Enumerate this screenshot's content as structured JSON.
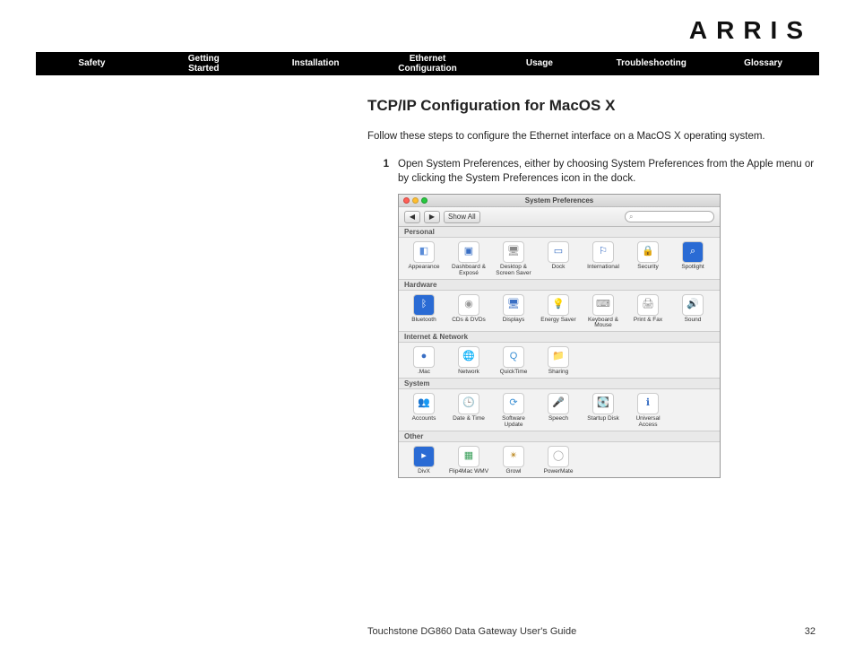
{
  "brand": "ARRIS",
  "nav": [
    "Safety",
    "Getting\nStarted",
    "Installation",
    "Ethernet\nConfiguration",
    "Usage",
    "Troubleshooting",
    "Glossary"
  ],
  "title": "TCP/IP Configuration for MacOS X",
  "intro": "Follow these steps to configure the Ethernet interface on a MacOS X operating system.",
  "step": {
    "num": "1",
    "text": "Open System Preferences, either by choosing System Preferences from the Apple menu or by clicking the System Preferences icon in the dock."
  },
  "sysprefs": {
    "windowTitle": "System Preferences",
    "showAll": "Show All",
    "searchGlyph": "⌕",
    "sections": [
      {
        "label": "Personal",
        "items": [
          {
            "name": "Appearance",
            "bg": "#fff",
            "glyph": "◧",
            "gc": "#5a8cd8"
          },
          {
            "name": "Dashboard & Exposé",
            "bg": "#fff",
            "glyph": "▣",
            "gc": "#3a6fc4"
          },
          {
            "name": "Desktop & Screen Saver",
            "bg": "#fff",
            "glyph": "🖥",
            "gc": "#888"
          },
          {
            "name": "Dock",
            "bg": "#fff",
            "glyph": "▭",
            "gc": "#3a6fc4"
          },
          {
            "name": "International",
            "bg": "#fff",
            "glyph": "⚐",
            "gc": "#2a62c0"
          },
          {
            "name": "Security",
            "bg": "#fff",
            "glyph": "🔒",
            "gc": "#777"
          },
          {
            "name": "Spotlight",
            "bg": "#2a6bd4",
            "glyph": "⌕",
            "gc": "#fff"
          }
        ]
      },
      {
        "label": "Hardware",
        "items": [
          {
            "name": "Bluetooth",
            "bg": "#2a6bd4",
            "glyph": "ᛒ",
            "gc": "#fff"
          },
          {
            "name": "CDs & DVDs",
            "bg": "#fff",
            "glyph": "◉",
            "gc": "#999"
          },
          {
            "name": "Displays",
            "bg": "#fff",
            "glyph": "🖥",
            "gc": "#3a6fc4"
          },
          {
            "name": "Energy Saver",
            "bg": "#fff",
            "glyph": "💡",
            "gc": "#e0c040"
          },
          {
            "name": "Keyboard & Mouse",
            "bg": "#fff",
            "glyph": "⌨",
            "gc": "#888"
          },
          {
            "name": "Print & Fax",
            "bg": "#fff",
            "glyph": "🖨",
            "gc": "#888"
          },
          {
            "name": "Sound",
            "bg": "#fff",
            "glyph": "🔊",
            "gc": "#b79a5a"
          }
        ]
      },
      {
        "label": "Internet & Network",
        "items": [
          {
            "name": ".Mac",
            "bg": "#fff",
            "glyph": "●",
            "gc": "#3a6fc4"
          },
          {
            "name": "Network",
            "bg": "#fff",
            "glyph": "🌐",
            "gc": "#3a6fc4"
          },
          {
            "name": "QuickTime",
            "bg": "#fff",
            "glyph": "Q",
            "gc": "#3a8fd4"
          },
          {
            "name": "Sharing",
            "bg": "#fff",
            "glyph": "📁",
            "gc": "#d4a03a"
          }
        ]
      },
      {
        "label": "System",
        "items": [
          {
            "name": "Accounts",
            "bg": "#fff",
            "glyph": "👥",
            "gc": "#333"
          },
          {
            "name": "Date & Time",
            "bg": "#fff",
            "glyph": "🕒",
            "gc": "#888"
          },
          {
            "name": "Software Update",
            "bg": "#fff",
            "glyph": "⟳",
            "gc": "#3a8fd4"
          },
          {
            "name": "Speech",
            "bg": "#fff",
            "glyph": "🎤",
            "gc": "#888"
          },
          {
            "name": "Startup Disk",
            "bg": "#fff",
            "glyph": "💽",
            "gc": "#888"
          },
          {
            "name": "Universal Access",
            "bg": "#fff",
            "glyph": "ℹ",
            "gc": "#3a6fc4"
          }
        ]
      },
      {
        "label": "Other",
        "items": [
          {
            "name": "DivX",
            "bg": "#2a6bd4",
            "glyph": "▸",
            "gc": "#fff"
          },
          {
            "name": "Flip4Mac WMV",
            "bg": "#fff",
            "glyph": "▦",
            "gc": "#3a9f5a"
          },
          {
            "name": "Growl",
            "bg": "#fff",
            "glyph": "✴",
            "gc": "#c09030"
          },
          {
            "name": "PowerMate",
            "bg": "#fff",
            "glyph": "◯",
            "gc": "#aaa"
          }
        ]
      }
    ]
  },
  "footer": {
    "left": "Touchstone DG860 Data Gateway User's Guide",
    "right": "32"
  }
}
